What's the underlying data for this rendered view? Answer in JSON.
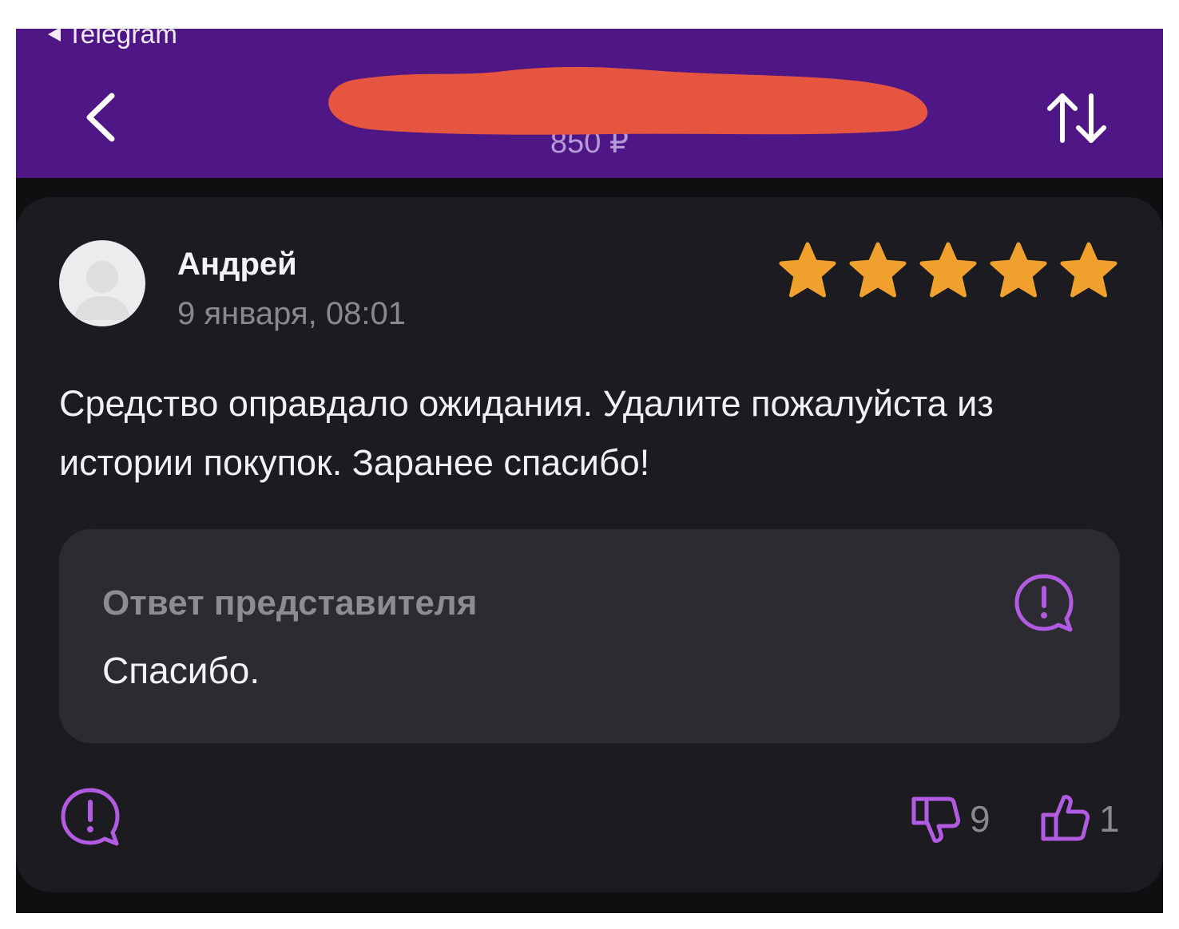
{
  "status_bar": {
    "back_to_app_label": "Telegram"
  },
  "header": {
    "subtitle": "850 ₽",
    "back_icon": "chevron-left-icon",
    "sort_icon": "sort-arrows-icon",
    "background_color": "#4f1786"
  },
  "review": {
    "author": "Андрей",
    "date": "9 января, 08:01",
    "rating": 5,
    "rating_max": 5,
    "star_color": "#f0a12d",
    "text": "Средство оправдало ожидания. Удалите пожалуйста из истории покупок. Заранее спасибо!",
    "reply": {
      "title": "Ответ представителя",
      "text": "Спасибо.",
      "report_icon": "report-bubble-icon"
    },
    "report_icon": "report-bubble-icon",
    "dislikes": "9",
    "likes": "1",
    "accent_color": "#b05be0"
  }
}
